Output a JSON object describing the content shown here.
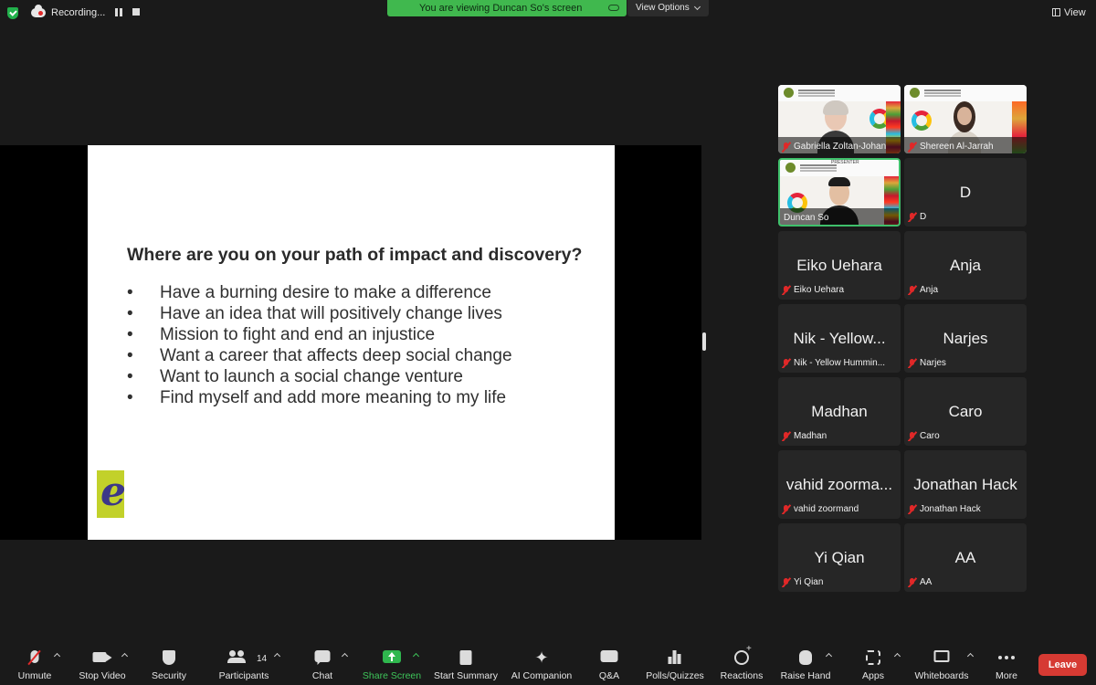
{
  "top_bar": {
    "recording_label": "Recording...",
    "viewing_banner": "You are viewing Duncan So's screen",
    "view_options_label": "View Options",
    "view_label": "View"
  },
  "slide": {
    "title": "Where are you on your path of impact and discovery?",
    "bullets": [
      "Have a burning desire to make a difference",
      "Have an idea that will positively change lives",
      "Mission to fight and end an injustice",
      "Want a career that affects deep social change",
      "Want to launch a social change venture",
      "Find myself and add more meaning to my life"
    ],
    "logo_letter": "e"
  },
  "participants": [
    {
      "display": "",
      "name": "Gabriella Zoltan-Johan",
      "video": true
    },
    {
      "display": "",
      "name": "Shereen Al-Jarrah",
      "video": true
    },
    {
      "display": "",
      "name": "Duncan So",
      "video": true,
      "badge": "PRESENTER"
    },
    {
      "display": "D",
      "name": "D",
      "video": false
    },
    {
      "display": "Eiko Uehara",
      "name": "Eiko Uehara",
      "video": false
    },
    {
      "display": "Anja",
      "name": "Anja",
      "video": false
    },
    {
      "display": "Nik - Yellow...",
      "name": "Nik - Yellow Hummin...",
      "video": false
    },
    {
      "display": "Narjes",
      "name": "Narjes",
      "video": false
    },
    {
      "display": "Madhan",
      "name": "Madhan",
      "video": false
    },
    {
      "display": "Caro",
      "name": "Caro",
      "video": false
    },
    {
      "display": "vahid zoorma...",
      "name": "vahid zoormand",
      "video": false
    },
    {
      "display": "Jonathan Hack",
      "name": "Jonathan Hack",
      "video": false
    },
    {
      "display": "Yi Qian",
      "name": "Yi Qian",
      "video": false
    },
    {
      "display": "AA",
      "name": "AA",
      "video": false
    }
  ],
  "toolbar": {
    "unmute": "Unmute",
    "stop_video": "Stop Video",
    "security": "Security",
    "participants": "Participants",
    "participant_count": "14",
    "chat": "Chat",
    "share_screen": "Share Screen",
    "start_summary": "Start Summary",
    "ai_companion": "AI Companion",
    "qa": "Q&A",
    "polls": "Polls/Quizzes",
    "reactions": "Reactions",
    "raise_hand": "Raise Hand",
    "apps": "Apps",
    "whiteboards": "Whiteboards",
    "more": "More",
    "leave": "Leave"
  },
  "colors": {
    "banner_green": "#40b84e",
    "leave_red": "#d63a33",
    "active_speaker": "#3fc06b",
    "muted_red": "#e02828"
  }
}
